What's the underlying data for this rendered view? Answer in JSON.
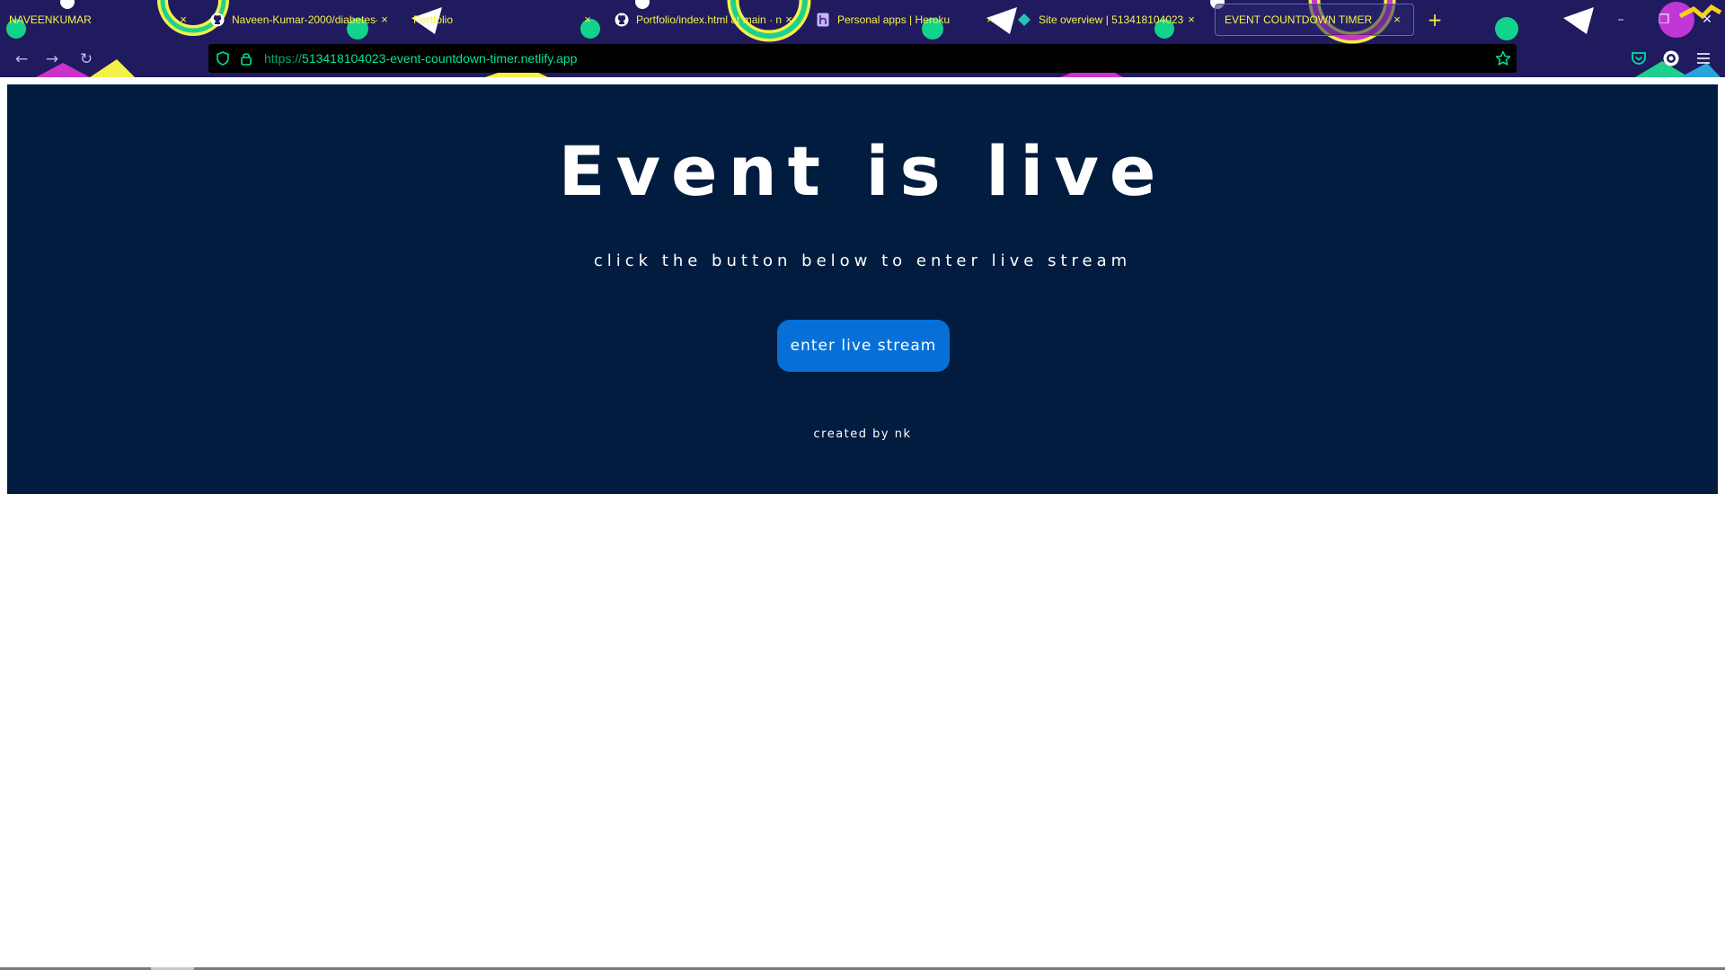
{
  "browser": {
    "tabs": [
      {
        "title": "NAVEENKUMAR",
        "favicon": "none",
        "active": false
      },
      {
        "title": "Naveen-Kumar-2000/diabetes-p",
        "favicon": "github-icon",
        "active": false
      },
      {
        "title": "Portfolio",
        "favicon": "none",
        "active": false
      },
      {
        "title": "Portfolio/index.html at main · n",
        "favicon": "github-icon",
        "active": false
      },
      {
        "title": "Personal apps | Heroku",
        "favicon": "heroku-icon",
        "active": false
      },
      {
        "title": "Site overview | 513418104023-ev",
        "favicon": "netlify-icon",
        "active": false
      },
      {
        "title": "EVENT COUNTDOWN TIMER",
        "favicon": "none",
        "active": true
      }
    ],
    "close_glyph": "×",
    "new_tab_glyph": "+",
    "url_protocol": "https://",
    "url_host": "513418104023-event-countdown-timer.netlify.app",
    "window_controls": {
      "minimize": "–",
      "restore": "❐",
      "close": "✕"
    },
    "nav": {
      "back": "←",
      "forward": "→",
      "reload": "↻"
    },
    "accent": "#f7f34a",
    "url_color": "#00e29a"
  },
  "page": {
    "title": "Event is live",
    "subtitle": "click the button below to enter live stream",
    "button_label": "enter live stream",
    "credit": "created by nk",
    "panel_color": "#011c3f",
    "button_color": "#0670d8"
  }
}
